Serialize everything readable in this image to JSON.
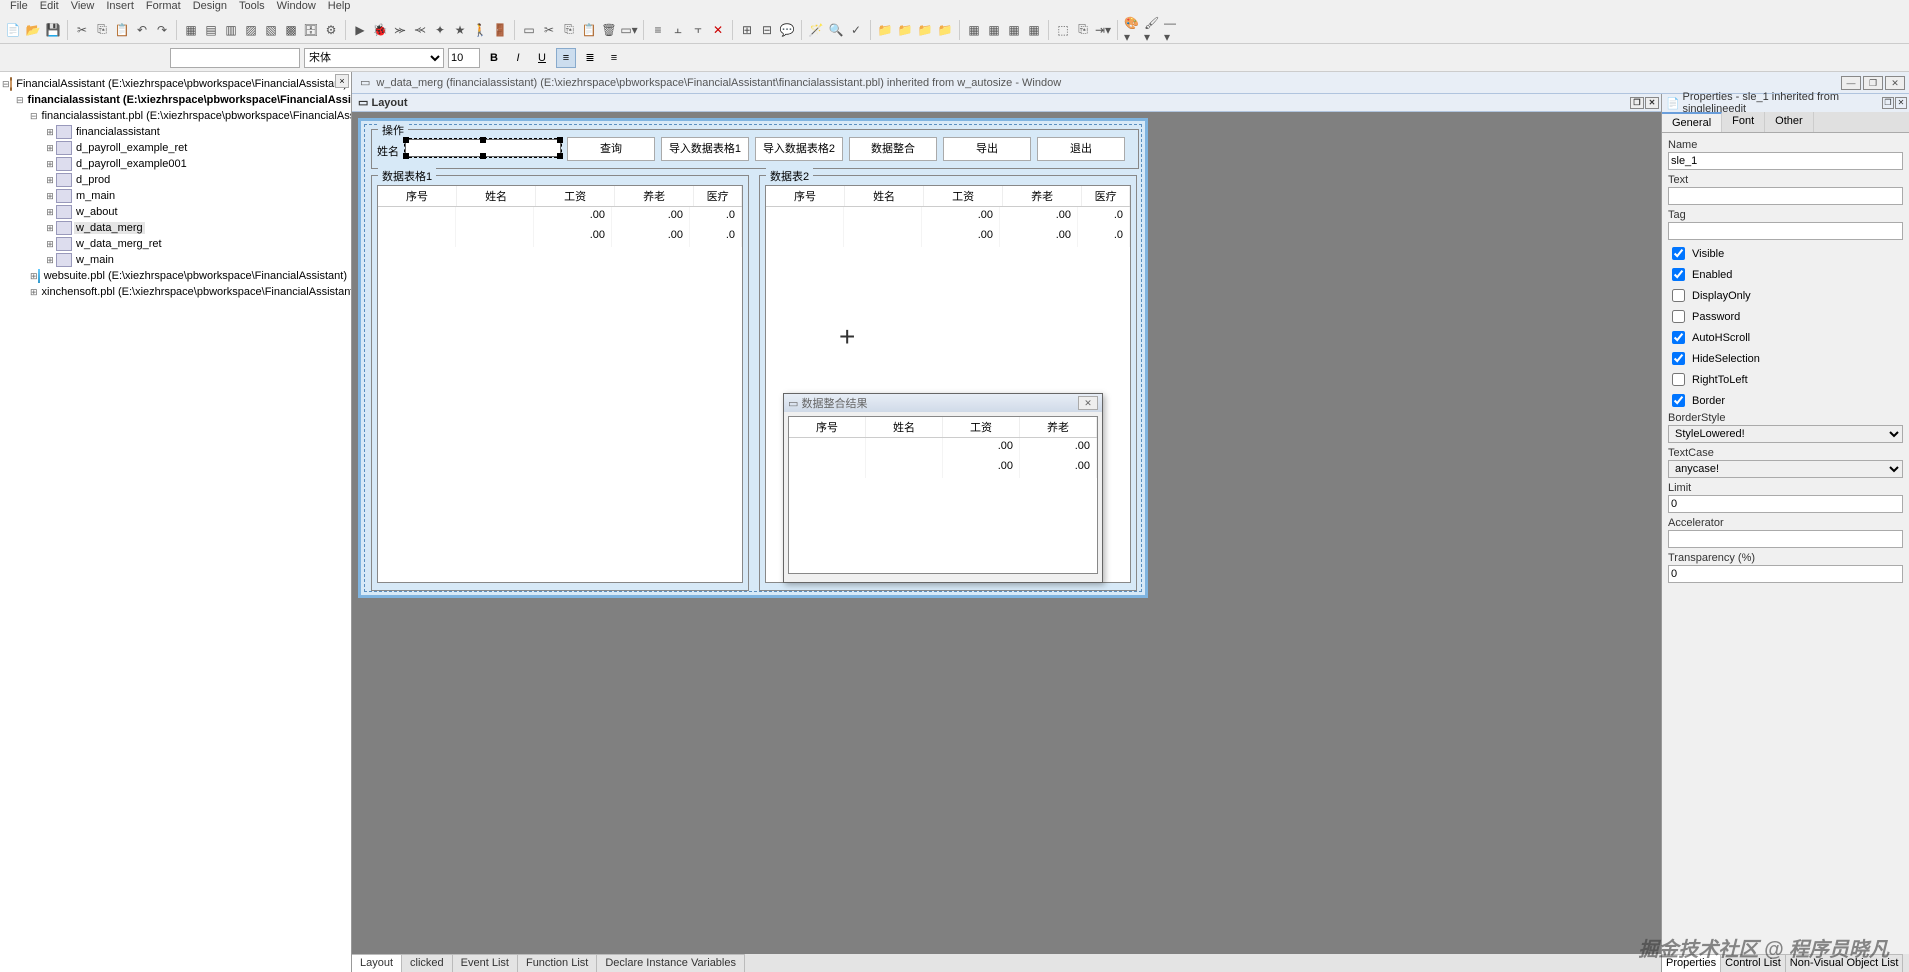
{
  "menu": [
    "File",
    "Edit",
    "View",
    "Insert",
    "Format",
    "Design",
    "Tools",
    "Window",
    "Help"
  ],
  "menu_underline": [
    "F",
    "E",
    "V",
    "I",
    "o",
    "D",
    "T",
    "W",
    "H"
  ],
  "format": {
    "font": "宋体",
    "size": "10"
  },
  "tree": {
    "root": "FinancialAssistant (E:\\xiezhrspace\\pbworkspace\\FinancialAssistant)",
    "target": "financialassistant (E:\\xiezhrspace\\pbworkspace\\FinancialAssista",
    "pbl": "financialassistant.pbl (E:\\xiezhrspace\\pbworkspace\\FinancialAssistant)",
    "objects": [
      "financialassistant",
      "d_payroll_example_ret",
      "d_payroll_example001",
      "d_prod",
      "m_main",
      "w_about",
      "w_data_merg",
      "w_data_merg_ret",
      "w_main"
    ],
    "extra": [
      "websuite.pbl (E:\\xiezhrspace\\pbworkspace\\FinancialAssistant)",
      "xinchensoft.pbl (E:\\xiezhrspace\\pbworkspace\\FinancialAssistant)"
    ]
  },
  "doc_title": "w_data_merg (financialassistant) (E:\\xiezhrspace\\pbworkspace\\FinancialAssistant\\financialassistant.pbl) inherited from w_autosize - Window",
  "layout_label": "Layout",
  "form": {
    "op_group": "操作",
    "name_label": "姓名",
    "buttons": [
      "查询",
      "导入数据表格1",
      "导入数据表格2",
      "数据整合",
      "导出",
      "退出"
    ],
    "dw1_title": "数据表格1",
    "dw2_title": "数据表2",
    "columns": [
      "序号",
      "姓名",
      "工资",
      "养老",
      "医疗"
    ],
    "popup_title": "数据整合结果",
    "popup_columns": [
      "序号",
      "姓名",
      "工资",
      "养老"
    ],
    "val_zero": ".00",
    "val_zero_cut": ".0"
  },
  "bottom_tabs": [
    "Layout",
    "clicked",
    "Event List",
    "Function List",
    "Declare Instance Variables"
  ],
  "props": {
    "title": "Properties - sle_1 inherited from singlelineedit",
    "tabs": [
      "General",
      "Font",
      "Other"
    ],
    "name_label": "Name",
    "name_value": "sle_1",
    "text_label": "Text",
    "text_value": "",
    "tag_label": "Tag",
    "tag_value": "",
    "checks": [
      {
        "label": "Visible",
        "checked": true
      },
      {
        "label": "Enabled",
        "checked": true
      },
      {
        "label": "DisplayOnly",
        "checked": false
      },
      {
        "label": "Password",
        "checked": false
      },
      {
        "label": "AutoHScroll",
        "checked": true
      },
      {
        "label": "HideSelection",
        "checked": true
      },
      {
        "label": "RightToLeft",
        "checked": false
      },
      {
        "label": "Border",
        "checked": true
      }
    ],
    "borderstyle_label": "BorderStyle",
    "borderstyle_value": "StyleLowered!",
    "textcase_label": "TextCase",
    "textcase_value": "anycase!",
    "limit_label": "Limit",
    "limit_value": "0",
    "accel_label": "Accelerator",
    "accel_value": "",
    "trans_label": "Transparency (%)",
    "trans_value": "0",
    "bottom_tabs": [
      "Properties",
      "Control List",
      "Non-Visual Object List"
    ]
  },
  "watermark": "掘金技术社区 @ 程序员晓凡"
}
